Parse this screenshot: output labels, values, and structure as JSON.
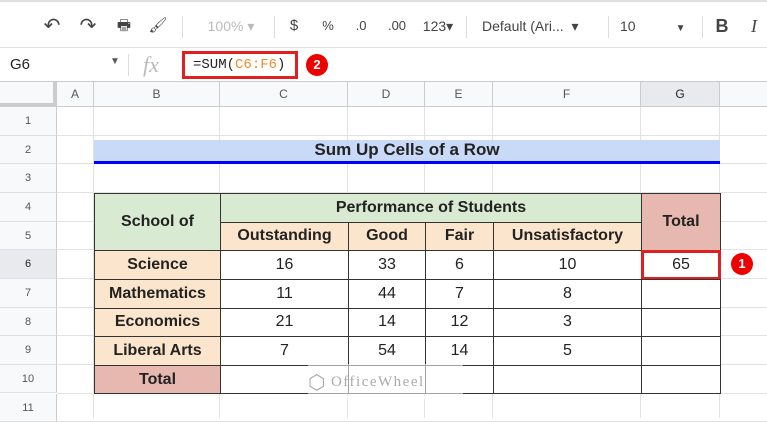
{
  "toolbar": {
    "zoom": "100%",
    "currency": "$",
    "percent": "%",
    "dec_decrease": ".0",
    "dec_increase": ".00",
    "format": "123▾",
    "font": "Default (Ari...",
    "font_size": "10",
    "bold": "B",
    "italic": "I"
  },
  "formula_bar": {
    "name_box": "G6",
    "fx": "fx",
    "formula_prefix": "=SUM(",
    "formula_ref": "C6:F6",
    "formula_suffix": ")",
    "badge": "2"
  },
  "columns": [
    "A",
    "B",
    "C",
    "D",
    "E",
    "F",
    "G"
  ],
  "rows": [
    "1",
    "2",
    "3",
    "4",
    "5",
    "6",
    "7",
    "8",
    "9",
    "10",
    "11"
  ],
  "sheet": {
    "title": "Sum Up Cells of a Row",
    "school_header": "School of",
    "performance_header": "Performance of Students",
    "total_header": "Total",
    "sub_headers": [
      "Outstanding",
      "Good",
      "Fair",
      "Unsatisfactory"
    ],
    "records": [
      {
        "school": "Science",
        "values": [
          "16",
          "33",
          "6",
          "10"
        ],
        "total": "65"
      },
      {
        "school": "Mathematics",
        "values": [
          "11",
          "44",
          "7",
          "8"
        ],
        "total": ""
      },
      {
        "school": "Economics",
        "values": [
          "21",
          "14",
          "12",
          "3"
        ],
        "total": ""
      },
      {
        "school": "Liberal Arts",
        "values": [
          "7",
          "54",
          "14",
          "5"
        ],
        "total": ""
      }
    ],
    "total_row_label": "Total",
    "selected_badge": "1"
  },
  "watermark": "OfficeWheel",
  "colors": {
    "green": "#d9ead3",
    "peach": "#fce5cd",
    "pink": "#e6b8af",
    "title_bg": "#c9daf8",
    "title_border": "#0000ff",
    "highlight": "#e02020"
  }
}
